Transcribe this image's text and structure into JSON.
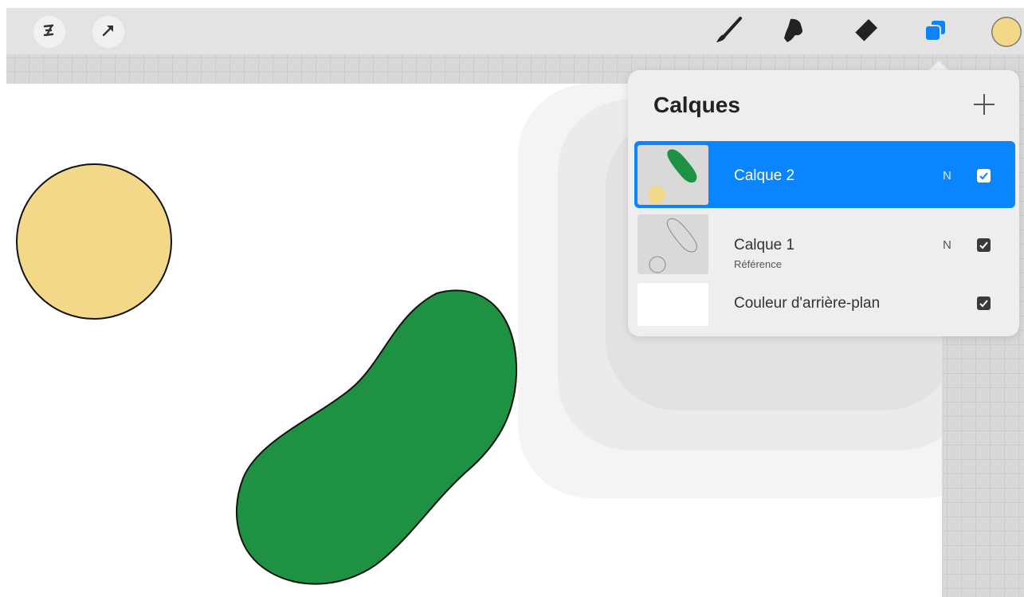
{
  "app": {
    "toolbar": {
      "left_tools": [
        {
          "icon": "modify-icon"
        },
        {
          "icon": "transform-arrow-icon"
        }
      ],
      "right_tools": [
        {
          "icon": "brush-icon"
        },
        {
          "icon": "smudge-icon"
        },
        {
          "icon": "eraser-icon"
        },
        {
          "icon": "layers-icon"
        }
      ],
      "current_color": "#f2d888"
    },
    "canvas": {
      "shapes": [
        {
          "kind": "circle",
          "fill": "#f2d888"
        },
        {
          "kind": "blob",
          "fill": "#1e9142"
        }
      ]
    },
    "layers_panel": {
      "title": "Calques",
      "add_icon": "plus-icon",
      "layers": [
        {
          "name": "Calque 2",
          "subtitle": "",
          "mode": "N",
          "visible": true,
          "selected": true
        },
        {
          "name": "Calque 1",
          "subtitle": "Référence",
          "mode": "N",
          "visible": true,
          "selected": false
        },
        {
          "name": "Couleur d'arrière-plan",
          "subtitle": "",
          "mode": "",
          "visible": true,
          "selected": false
        }
      ],
      "accent": "#0a84ff"
    }
  }
}
